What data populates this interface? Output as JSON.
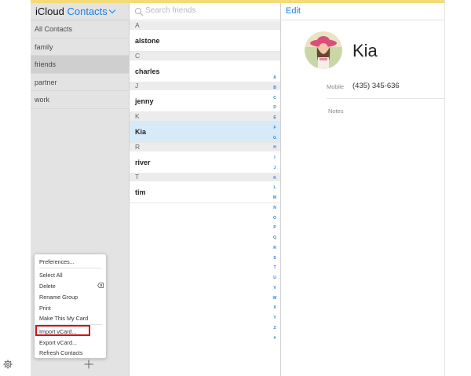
{
  "app": {
    "brand_name": "iCloud",
    "brand_app": "Contacts",
    "accent_color": "#1a82e2",
    "topbar_color": "#f3dc78"
  },
  "sidebar": {
    "groups": [
      {
        "label": "All Contacts",
        "selected": false
      },
      {
        "label": "family",
        "selected": false
      },
      {
        "label": "friends",
        "selected": true
      },
      {
        "label": "partner",
        "selected": false
      },
      {
        "label": "work",
        "selected": false
      }
    ],
    "settings_icon": "gear-icon",
    "add_icon": "plus-icon"
  },
  "menu": {
    "items": [
      {
        "label": "Preferences..."
      },
      {
        "label": "Select All"
      },
      {
        "label": "Delete",
        "icon": "delete-key-icon"
      },
      {
        "label": "Rename Group"
      },
      {
        "label": "Print"
      },
      {
        "label": "Make This My Card"
      },
      {
        "label": "Import vCard...",
        "highlighted": true
      },
      {
        "label": "Export vCard..."
      },
      {
        "label": "Refresh Contacts"
      }
    ],
    "highlight_color": "#d0121b"
  },
  "search": {
    "placeholder": "Search friends",
    "icon": "search-icon"
  },
  "contacts": {
    "sections": [
      {
        "letter": "A",
        "names": [
          "alstone"
        ]
      },
      {
        "letter": "C",
        "names": [
          "charles"
        ]
      },
      {
        "letter": "J",
        "names": [
          "jenny"
        ]
      },
      {
        "letter": "K",
        "names": [
          "Kia"
        ]
      },
      {
        "letter": "R",
        "names": [
          "river"
        ]
      },
      {
        "letter": "T",
        "names": [
          "tim"
        ]
      }
    ],
    "selected": "Kia",
    "index_letters": [
      "A",
      "B",
      "C",
      "D",
      "E",
      "F",
      "G",
      "H",
      "I",
      "J",
      "K",
      "L",
      "M",
      "N",
      "O",
      "P",
      "Q",
      "R",
      "S",
      "T",
      "U",
      "V",
      "W",
      "X",
      "Y",
      "Z",
      "#"
    ]
  },
  "detail": {
    "edit_label": "Edit",
    "name": "Kia",
    "mobile_label": "Mobile",
    "mobile_value": "(435) 345-636",
    "notes_label": "Notes",
    "avatar": "contact-photo"
  }
}
